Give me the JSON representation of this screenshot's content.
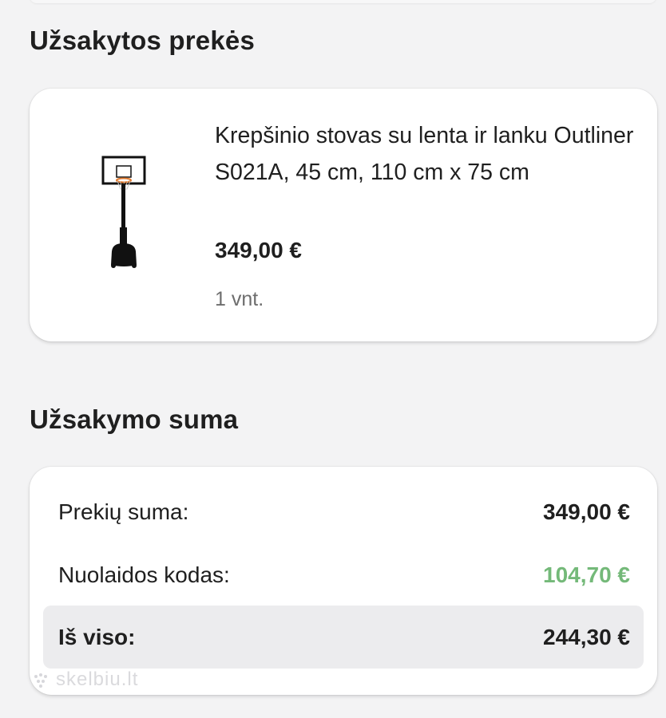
{
  "sections": {
    "items_title": "Užsakytos prekės",
    "total_title": "Užsakymo suma"
  },
  "product": {
    "name": "Krepšinio stovas su lenta ir lanku Outliner S021A, 45 cm, 110 cm x 75 cm",
    "price": "349,00 €",
    "quantity": "1 vnt.",
    "image_icon": "basketball-stand-image"
  },
  "summary": {
    "subtotal_label": "Prekių suma:",
    "subtotal_value": "349,00 €",
    "discount_label": "Nuolaidos kodas:",
    "discount_value": "104,70 €",
    "total_label": "Iš viso:",
    "total_value": "244,30 €"
  },
  "watermark": {
    "text": "skelbiu.lt"
  },
  "colors": {
    "page_background": "#f3f3f4",
    "card_background": "#ffffff",
    "discount_green": "#74b979",
    "total_box": "#ececee"
  }
}
